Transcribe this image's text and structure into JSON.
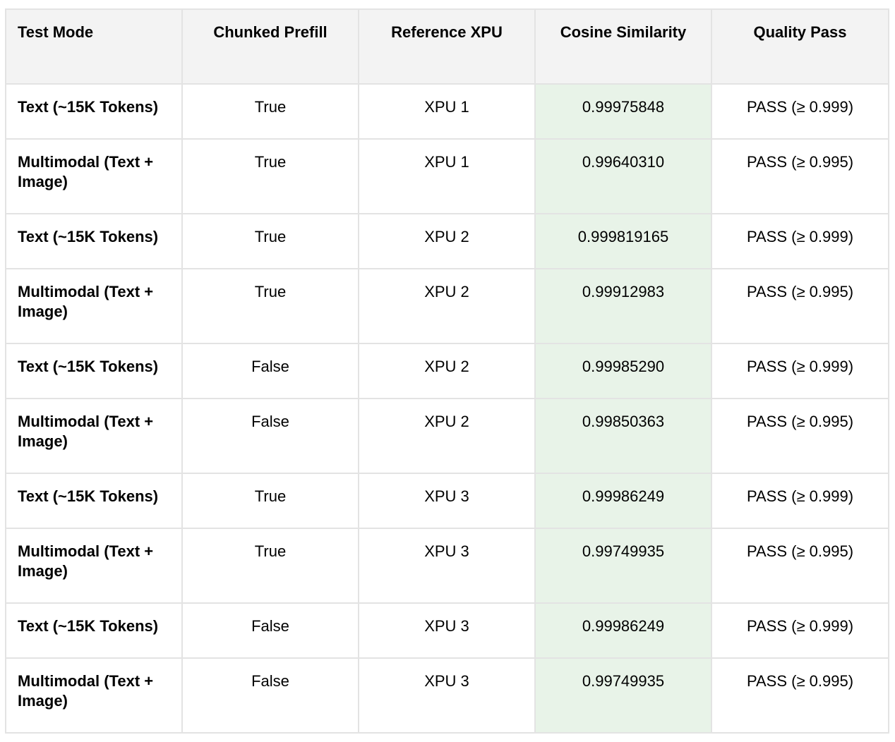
{
  "table": {
    "headers": [
      "Test Mode",
      "Chunked Prefill",
      "Reference XPU",
      "Cosine Similarity",
      "Quality Pass"
    ],
    "rows": [
      {
        "mode": "Text (~15K Tokens)",
        "chunked": "True",
        "xpu": "XPU 1",
        "cosine": "0.99975848",
        "quality": "PASS (≥ 0.999)"
      },
      {
        "mode": "Multimodal (Text + Image)",
        "chunked": "True",
        "xpu": "XPU 1",
        "cosine": "0.99640310",
        "quality": "PASS (≥ 0.995)"
      },
      {
        "mode": "Text (~15K Tokens)",
        "chunked": "True",
        "xpu": "XPU 2",
        "cosine": "0.999819165",
        "quality": "PASS (≥ 0.999)"
      },
      {
        "mode": "Multimodal (Text + Image)",
        "chunked": "True",
        "xpu": "XPU 2",
        "cosine": "0.99912983",
        "quality": "PASS (≥ 0.995)"
      },
      {
        "mode": "Text (~15K Tokens)",
        "chunked": "False",
        "xpu": "XPU 2",
        "cosine": "0.99985290",
        "quality": "PASS (≥ 0.999)"
      },
      {
        "mode": "Multimodal (Text + Image)",
        "chunked": "False",
        "xpu": "XPU 2",
        "cosine": "0.99850363",
        "quality": "PASS (≥ 0.995)"
      },
      {
        "mode": "Text (~15K Tokens)",
        "chunked": "True",
        "xpu": "XPU 3",
        "cosine": "0.99986249",
        "quality": "PASS (≥ 0.999)"
      },
      {
        "mode": "Multimodal (Text + Image)",
        "chunked": "True",
        "xpu": "XPU 3",
        "cosine": "0.99749935",
        "quality": "PASS (≥ 0.995)"
      },
      {
        "mode": "Text (~15K Tokens)",
        "chunked": "False",
        "xpu": "XPU 3",
        "cosine": "0.99986249",
        "quality": "PASS (≥ 0.999)"
      },
      {
        "mode": "Multimodal (Text + Image)",
        "chunked": "False",
        "xpu": "XPU 3",
        "cosine": "0.99749935",
        "quality": "PASS (≥ 0.995)"
      }
    ]
  },
  "colors": {
    "header_background": "#f3f3f3",
    "cosine_column_background": "#e8f3e8",
    "grid_line": "#e3e3e3"
  }
}
